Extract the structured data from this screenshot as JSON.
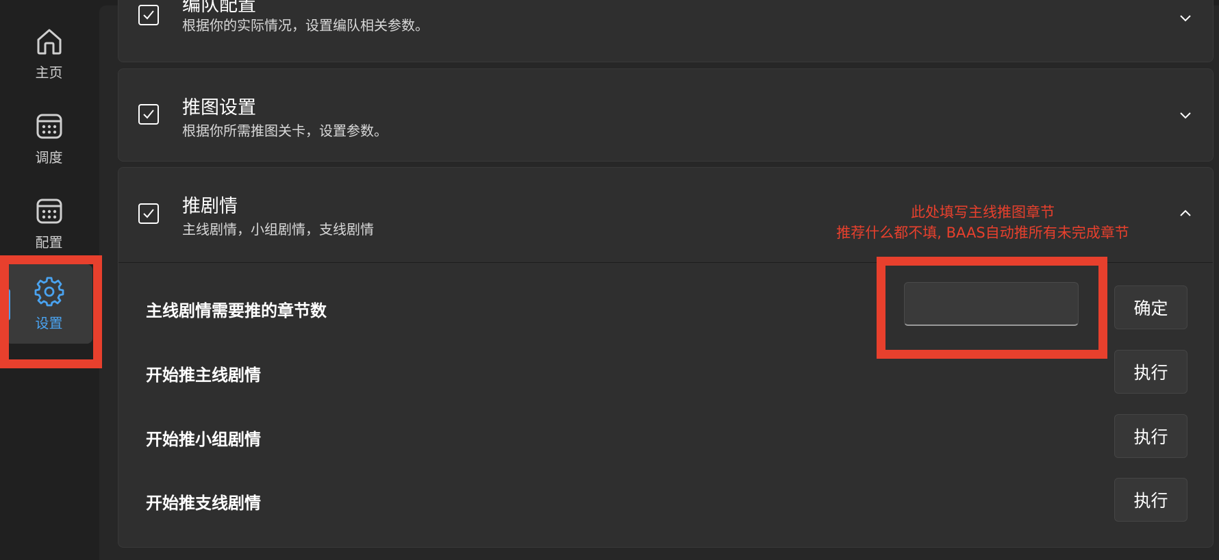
{
  "nav": {
    "items": [
      {
        "label": "主页",
        "icon": "home-icon"
      },
      {
        "label": "调度",
        "icon": "calendar-icon"
      },
      {
        "label": "配置",
        "icon": "calendar-icon"
      },
      {
        "label": "设置",
        "icon": "gear-icon",
        "active": true
      }
    ]
  },
  "cards": {
    "team": {
      "title": "编队配置",
      "subtitle": "根据你的实际情况，设置编队相关参数。",
      "checked": true,
      "expanded": false
    },
    "push_map": {
      "title": "推图设置",
      "subtitle": "根据你所需推图关卡，设置参数。",
      "checked": true,
      "expanded": false
    },
    "story": {
      "title": "推剧情",
      "subtitle": "主线剧情，小组剧情，支线剧情",
      "checked": true,
      "expanded": true,
      "rows": [
        {
          "label": "主线剧情需要推的章节数",
          "input_value": "",
          "button": "确定"
        },
        {
          "label": "开始推主线剧情",
          "button": "执行"
        },
        {
          "label": "开始推小组剧情",
          "button": "执行"
        },
        {
          "label": "开始推支线剧情",
          "button": "执行"
        }
      ]
    }
  },
  "annotation": {
    "line1": "此处填写主线推图章节",
    "line2": "推荐什么都不填, BAAS自动推所有未完成章节",
    "color": "#e8402d"
  },
  "colors": {
    "accent": "#4aa3f0",
    "annotation": "#e8402d"
  }
}
